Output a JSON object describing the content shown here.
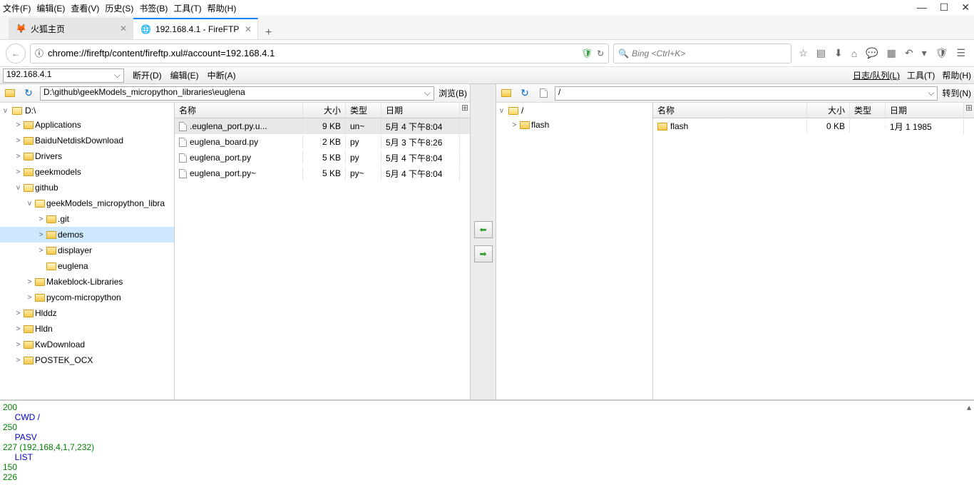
{
  "menubar": [
    "文件(F)",
    "编辑(E)",
    "查看(V)",
    "历史(S)",
    "书签(B)",
    "工具(T)",
    "帮助(H)"
  ],
  "window_controls": [
    "—",
    "☐",
    "✕"
  ],
  "tabs": [
    {
      "label": "火狐主页",
      "active": false
    },
    {
      "label": "192.168.4.1 - FireFTP",
      "active": true
    }
  ],
  "urlbar": {
    "info_icon": "ⓘ",
    "url": "chrome://fireftp/content/fireftp.xul#account=192.168.4.1",
    "shield": "🛡",
    "reload": "↻"
  },
  "searchbar": {
    "placeholder": "Bing <Ctrl+K>",
    "icon": "🔍"
  },
  "toolbar_icons": [
    "☆",
    "▤",
    "⬇",
    "⌂",
    "💬",
    "▦",
    "↶",
    "▾",
    "🛡",
    "☰"
  ],
  "ftp_toolbar": {
    "account": "192.168.4.1",
    "actions": [
      "断开(D)",
      "编辑(E)",
      "中断(A)"
    ],
    "right": [
      "日志/队列(L)",
      "工具(T)",
      "帮助(H)"
    ]
  },
  "local": {
    "path": "D:\\github\\geekModels_micropython_libraries\\euglena",
    "browse_btn": "浏览(B)",
    "drive": "D:\\",
    "tree": [
      {
        "label": "Applications",
        "depth": 1,
        "exp": ">"
      },
      {
        "label": "BaiduNetdiskDownload",
        "depth": 1,
        "exp": ">"
      },
      {
        "label": "Drivers",
        "depth": 1,
        "exp": ">"
      },
      {
        "label": "geekmodels",
        "depth": 1,
        "exp": ">"
      },
      {
        "label": "github",
        "depth": 1,
        "exp": "v",
        "open": true
      },
      {
        "label": "geekModels_micropython_libra",
        "depth": 2,
        "exp": "v",
        "open": true
      },
      {
        "label": ".git",
        "depth": 3,
        "exp": ">"
      },
      {
        "label": "demos",
        "depth": 3,
        "exp": ">",
        "selected": true
      },
      {
        "label": "displayer",
        "depth": 3,
        "exp": ">"
      },
      {
        "label": "euglena",
        "depth": 3,
        "exp": "",
        "open": true
      },
      {
        "label": "Makeblock-Libraries",
        "depth": 2,
        "exp": ">"
      },
      {
        "label": "pycom-micropython",
        "depth": 2,
        "exp": ">"
      },
      {
        "label": "Hlddz",
        "depth": 1,
        "exp": ">"
      },
      {
        "label": "Hldn",
        "depth": 1,
        "exp": ">"
      },
      {
        "label": "KwDownload",
        "depth": 1,
        "exp": ">"
      },
      {
        "label": "POSTEK_OCX",
        "depth": 1,
        "exp": ">"
      }
    ],
    "columns": {
      "name": "名称",
      "size": "大小",
      "type": "类型",
      "date": "日期"
    },
    "files": [
      {
        "name": ".euglena_port.py.u...",
        "size": "9 KB",
        "type": "un~",
        "date": "5月 4 下午8:04",
        "selected": true
      },
      {
        "name": "euglena_board.py",
        "size": "2 KB",
        "type": "py",
        "date": "5月 3 下午8:26"
      },
      {
        "name": "euglena_port.py",
        "size": "5 KB",
        "type": "py",
        "date": "5月 4 下午8:04"
      },
      {
        "name": "euglena_port.py~",
        "size": "5 KB",
        "type": "py~",
        "date": "5月 4 下午8:04"
      }
    ]
  },
  "remote": {
    "path": "/",
    "goto_btn": "转到(N)",
    "root": "/",
    "tree": [
      {
        "label": "flash",
        "depth": 1,
        "exp": ">"
      }
    ],
    "columns": {
      "name": "名称",
      "size": "大小",
      "type": "类型",
      "date": "日期"
    },
    "files": [
      {
        "name": "flash",
        "size": "0 KB",
        "type": "",
        "date": "1月 1 1985",
        "folder": true
      }
    ]
  },
  "transfer": {
    "left": "⬅",
    "right": "➡"
  },
  "log": [
    {
      "cls": "green",
      "text": "200"
    },
    {
      "cls": "blue",
      "text": "     CWD /"
    },
    {
      "cls": "green",
      "text": "250"
    },
    {
      "cls": "blue",
      "text": "     PASV"
    },
    {
      "cls": "green",
      "text": "227 (192,168,4,1,7,232)"
    },
    {
      "cls": "blue",
      "text": "     LIST"
    },
    {
      "cls": "green",
      "text": "150"
    },
    {
      "cls": "green",
      "text": "226"
    }
  ]
}
